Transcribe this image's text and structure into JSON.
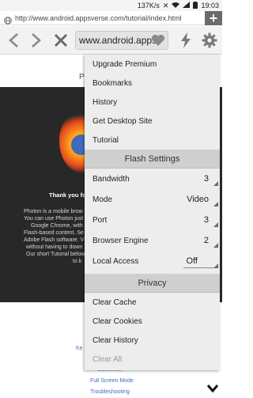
{
  "status_bar": {
    "speed": "137K/s",
    "time": "19:03"
  },
  "url_bar": {
    "url": "http://www.android.appsverse.com/tutorial/index.html"
  },
  "toolbar": {
    "address_text": "www.android.apps"
  },
  "page": {
    "top_text": "P",
    "thanks": "Thank you fo",
    "paragraph": [
      "Photon is a mobile brow",
      "You can use Photon just",
      "Google Chrome, with",
      "Flash-based content. Se",
      "Adobe Flash software. V",
      "without having to down",
      "Our short Tutorial below",
      "to k"
    ],
    "links": [
      "Ke",
      "Bandwidth",
      "Full Screen Mode",
      "Troubleshooting"
    ]
  },
  "menu": {
    "items_top": [
      "Upgrade Premium",
      "Bookmarks",
      "History",
      "Get Desktop Site",
      "Tutorial"
    ],
    "flash_header": "Flash Settings",
    "settings": [
      {
        "label": "Bandwidth",
        "value": "3"
      },
      {
        "label": "Mode",
        "value": "Video"
      },
      {
        "label": "Port",
        "value": "3"
      },
      {
        "label": "Browser Engine",
        "value": "2"
      },
      {
        "label": "Local Access",
        "value": "Off"
      }
    ],
    "privacy_header": "Privacy",
    "privacy_items": [
      "Clear Cache",
      "Clear Cookies",
      "Clear History",
      "Clear All"
    ]
  }
}
